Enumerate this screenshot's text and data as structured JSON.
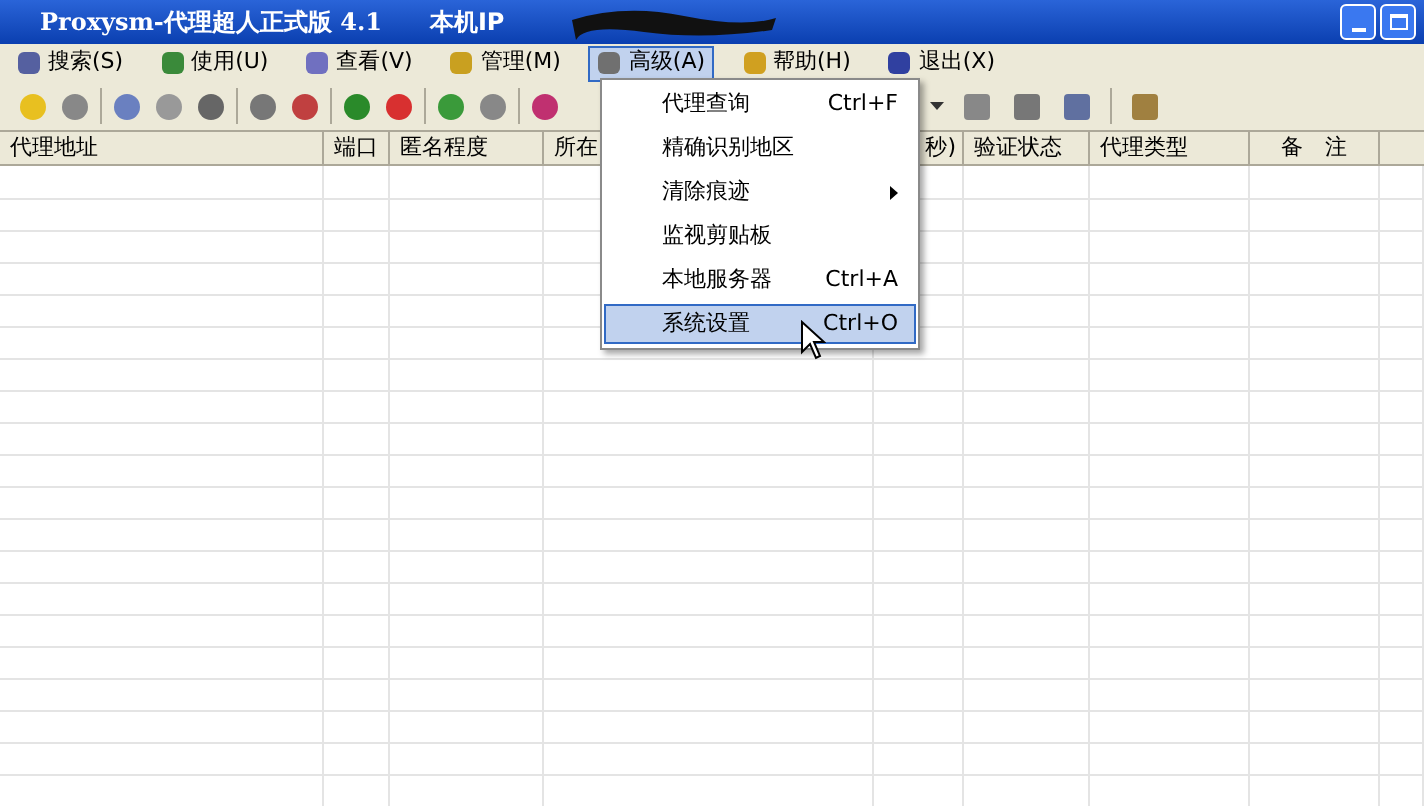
{
  "window": {
    "title": "Proxysm-代理超人正式版 4.1",
    "title_suffix": "本机IP"
  },
  "menu_bar": [
    {
      "label": "搜索(S)",
      "selected": false
    },
    {
      "label": "使用(U)",
      "selected": false
    },
    {
      "label": "查看(V)",
      "selected": false
    },
    {
      "label": "管理(M)",
      "selected": false
    },
    {
      "label": "高级(A)",
      "selected": true
    },
    {
      "label": "帮助(H)",
      "selected": false
    },
    {
      "label": "退出(X)",
      "selected": false
    }
  ],
  "table": {
    "columns": [
      "代理地址",
      "端口",
      "匿名程度",
      "所在",
      "秒)",
      "验证状态",
      "代理类型",
      "备　注"
    ]
  },
  "dropdown_menu": [
    {
      "label": "代理查询",
      "shortcut": "Ctrl+F",
      "submenu": false,
      "selected": false
    },
    {
      "label": "精确识别地区",
      "submenu": false,
      "selected": false
    },
    {
      "label": "清除痕迹",
      "submenu": true,
      "selected": false
    },
    {
      "label": "监视剪贴板",
      "submenu": false,
      "selected": false
    },
    {
      "label": "本地服务器",
      "shortcut": "Ctrl+A",
      "submenu": false,
      "selected": false
    },
    {
      "label": "系统设置",
      "shortcut": "Ctrl+O",
      "submenu": false,
      "selected": true
    }
  ]
}
